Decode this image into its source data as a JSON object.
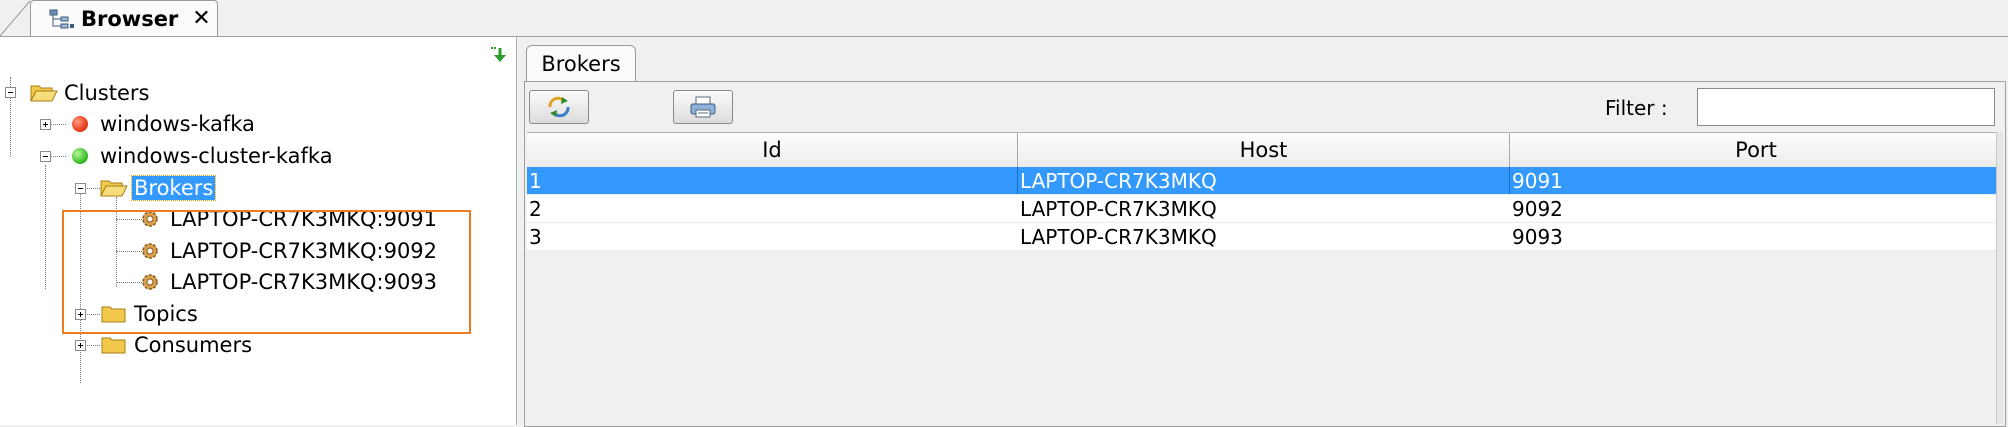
{
  "window": {
    "tab_title": "Browser",
    "close_glyph": "✕",
    "tab_icon": "tree-view-icon"
  },
  "tree": {
    "collapse_icon": "collapse-all-icon",
    "root": "Clusters",
    "clusters": [
      {
        "label": "windows-kafka",
        "status": "red"
      },
      {
        "label": "windows-cluster-kafka",
        "status": "green"
      }
    ],
    "brokers_folder": "Brokers",
    "brokers": [
      "LAPTOP-CR7K3MKQ:9091",
      "LAPTOP-CR7K3MKQ:9092",
      "LAPTOP-CR7K3MKQ:9093"
    ],
    "topics_folder": "Topics",
    "consumers_folder": "Consumers"
  },
  "right": {
    "tab": "Brokers",
    "refresh_icon": "refresh-icon",
    "export_icon": "export-icon",
    "filter_label": "Filter :",
    "filter_value": "",
    "columns": [
      "Id",
      "Host",
      "Port"
    ],
    "rows": [
      [
        "1",
        "LAPTOP-CR7K3MKQ",
        "9091"
      ],
      [
        "2",
        "LAPTOP-CR7K3MKQ",
        "9092"
      ],
      [
        "3",
        "LAPTOP-CR7K3MKQ",
        "9093"
      ]
    ],
    "selected_row": 0
  },
  "colors": {
    "selection": "#3399ff",
    "highlight_border": "#ee7a22"
  }
}
